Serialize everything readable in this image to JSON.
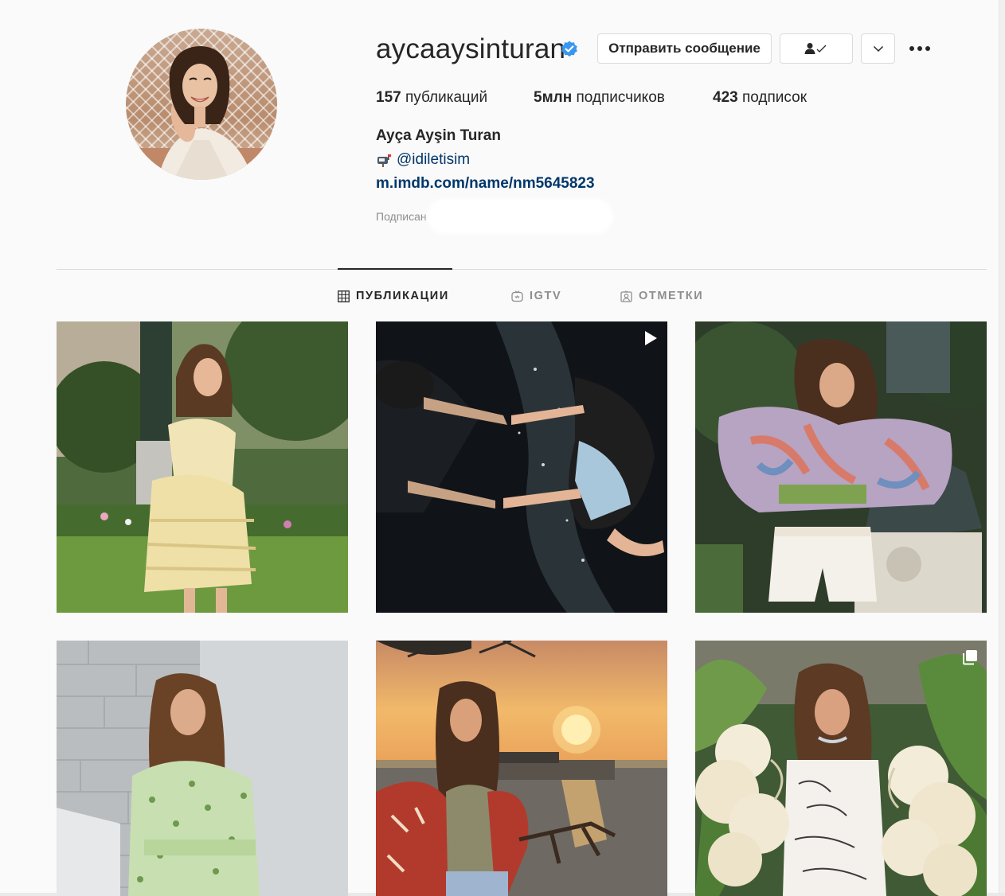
{
  "profile": {
    "username": "aycaaysinturan",
    "verified": true,
    "full_name": "Ayça Ayşin Turan",
    "contact": "@idiletisim",
    "link": "m.imdb.com/name/nm5645823",
    "followed_by_label": "Подписан"
  },
  "actions": {
    "message_label": "Отправить сообщение",
    "follow_icon": "person-check-icon",
    "dropdown_icon": "chevron-down-icon",
    "more_icon": "ellipsis-icon"
  },
  "stats": {
    "posts_count": "157",
    "posts_label": "публикаций",
    "followers_count": "5млн",
    "followers_label": "подписчиков",
    "following_count": "423",
    "following_label": "подписок"
  },
  "tabs": [
    {
      "label": "ПУБЛИКАЦИИ",
      "icon": "grid-icon",
      "active": true
    },
    {
      "label": "IGTV",
      "icon": "igtv-icon",
      "active": false
    },
    {
      "label": "ОТМЕТКИ",
      "icon": "tagged-icon",
      "active": false
    }
  ],
  "posts": [
    {
      "badge": null,
      "icon": null
    },
    {
      "badge": "video",
      "icon": "play-icon"
    },
    {
      "badge": null,
      "icon": null
    },
    {
      "badge": null,
      "icon": null
    },
    {
      "badge": null,
      "icon": null
    },
    {
      "badge": "carousel",
      "icon": "carousel-icon"
    }
  ],
  "colors": {
    "background": "#fafafa",
    "text": "#262626",
    "secondary_text": "#8e8e8e",
    "link": "#00376b",
    "border": "#dbdbdb",
    "verified": "#3897f0"
  }
}
